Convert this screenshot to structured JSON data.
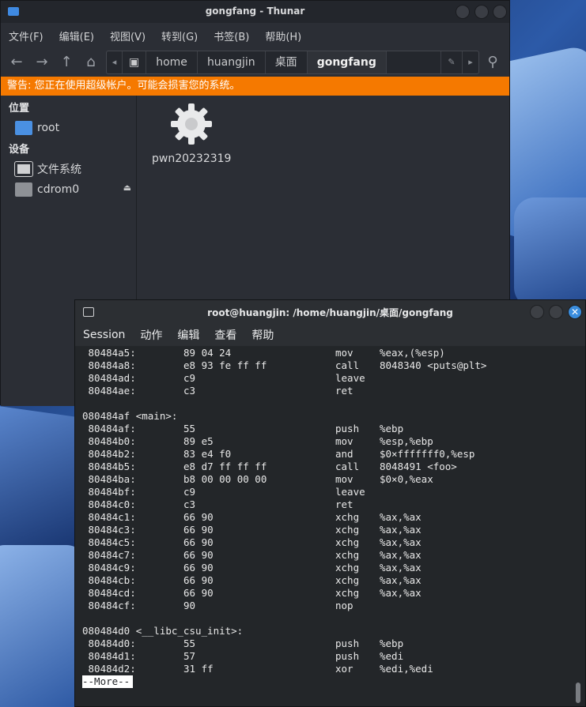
{
  "thunar": {
    "title": "gongfang - Thunar",
    "menu": [
      "文件(F)",
      "编辑(E)",
      "视图(V)",
      "转到(G)",
      "书签(B)",
      "帮助(H)"
    ],
    "path": [
      "home",
      "huangjin",
      "桌面",
      "gongfang"
    ],
    "warning": "警告: 您正在使用超级帐户。可能会损害您的系统。",
    "sidebar": {
      "places_heading": "位置",
      "places": [
        {
          "label": "root",
          "icon": "home-folder-icon"
        }
      ],
      "devices_heading": "设备",
      "devices": [
        {
          "label": "文件系统",
          "icon": "drive-icon"
        },
        {
          "label": "cdrom0",
          "icon": "optical-drive-icon"
        }
      ]
    },
    "files": [
      {
        "name": "pwn20232319",
        "icon": "executable-gear-icon"
      }
    ]
  },
  "konsole": {
    "title": "root@huangjin: /home/huangjin/桌面/gongfang",
    "menu": [
      "Session",
      "动作",
      "编辑",
      "查看",
      "帮助"
    ],
    "lines": [
      {
        "addr": " 80484a5:",
        "bytes": "89 04 24",
        "mnem": "mov",
        "ops": "%eax,(%esp)"
      },
      {
        "addr": " 80484a8:",
        "bytes": "e8 93 fe ff ff",
        "mnem": "call",
        "ops": "8048340 <puts@plt>"
      },
      {
        "addr": " 80484ad:",
        "bytes": "c9",
        "mnem": "leave",
        "ops": ""
      },
      {
        "addr": " 80484ae:",
        "bytes": "c3",
        "mnem": "ret",
        "ops": ""
      },
      {
        "addr": "",
        "bytes": "",
        "mnem": "",
        "ops": ""
      },
      {
        "addr": "080484af <main>:",
        "bytes": "",
        "mnem": "",
        "ops": ""
      },
      {
        "addr": " 80484af:",
        "bytes": "55",
        "mnem": "push",
        "ops": "%ebp"
      },
      {
        "addr": " 80484b0:",
        "bytes": "89 e5",
        "mnem": "mov",
        "ops": "%esp,%ebp"
      },
      {
        "addr": " 80484b2:",
        "bytes": "83 e4 f0",
        "mnem": "and",
        "ops": "$0×fffffff0,%esp"
      },
      {
        "addr": " 80484b5:",
        "bytes": "e8 d7 ff ff ff",
        "mnem": "call",
        "ops": "8048491 <foo>"
      },
      {
        "addr": " 80484ba:",
        "bytes": "b8 00 00 00 00",
        "mnem": "mov",
        "ops": "$0×0,%eax"
      },
      {
        "addr": " 80484bf:",
        "bytes": "c9",
        "mnem": "leave",
        "ops": ""
      },
      {
        "addr": " 80484c0:",
        "bytes": "c3",
        "mnem": "ret",
        "ops": ""
      },
      {
        "addr": " 80484c1:",
        "bytes": "66 90",
        "mnem": "xchg",
        "ops": "%ax,%ax"
      },
      {
        "addr": " 80484c3:",
        "bytes": "66 90",
        "mnem": "xchg",
        "ops": "%ax,%ax"
      },
      {
        "addr": " 80484c5:",
        "bytes": "66 90",
        "mnem": "xchg",
        "ops": "%ax,%ax"
      },
      {
        "addr": " 80484c7:",
        "bytes": "66 90",
        "mnem": "xchg",
        "ops": "%ax,%ax"
      },
      {
        "addr": " 80484c9:",
        "bytes": "66 90",
        "mnem": "xchg",
        "ops": "%ax,%ax"
      },
      {
        "addr": " 80484cb:",
        "bytes": "66 90",
        "mnem": "xchg",
        "ops": "%ax,%ax"
      },
      {
        "addr": " 80484cd:",
        "bytes": "66 90",
        "mnem": "xchg",
        "ops": "%ax,%ax"
      },
      {
        "addr": " 80484cf:",
        "bytes": "90",
        "mnem": "nop",
        "ops": ""
      },
      {
        "addr": "",
        "bytes": "",
        "mnem": "",
        "ops": ""
      },
      {
        "addr": "080484d0 <__libc_csu_init>:",
        "bytes": "",
        "mnem": "",
        "ops": ""
      },
      {
        "addr": " 80484d0:",
        "bytes": "55",
        "mnem": "push",
        "ops": "%ebp"
      },
      {
        "addr": " 80484d1:",
        "bytes": "57",
        "mnem": "push",
        "ops": "%edi"
      },
      {
        "addr": " 80484d2:",
        "bytes": "31 ff",
        "mnem": "xor",
        "ops": "%edi,%edi"
      }
    ],
    "pager_prompt": "--More--"
  },
  "colors": {
    "warning": "#f57900",
    "accent": "#3a8dde"
  }
}
